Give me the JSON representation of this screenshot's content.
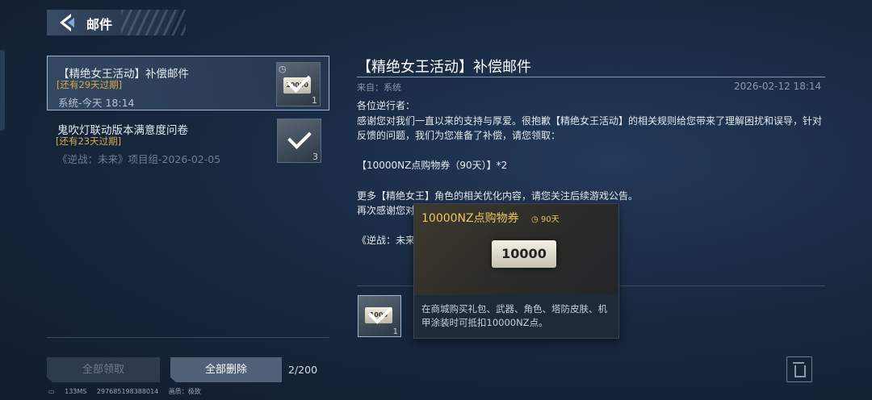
{
  "header": {
    "title": "邮件",
    "back_icon": "back-arrow-icon"
  },
  "mail_list": [
    {
      "title": "【精绝女王活动】补偿邮件",
      "expiry": "[还有29天过期]",
      "meta": "系统-今天 18:14",
      "ticket_label": "10000",
      "count": "1",
      "selected": true
    },
    {
      "title": "鬼吹灯联动版本满意度问卷",
      "expiry": "[还有23天过期]",
      "meta": "《逆战：未来》项目组-2026-02-05",
      "count": "3",
      "selected": false
    }
  ],
  "footer": {
    "collect_all": "全部领取",
    "delete_all": "全部删除",
    "mail_count": "2/200",
    "status_latency": "133MS",
    "status_id": "297685198388014",
    "status_quality": "画质：极致"
  },
  "detail": {
    "title": "【精绝女王活动】补偿邮件",
    "from": "来自：系统",
    "time": "2026-02-12 18:14",
    "body": [
      "各位逆行者：",
      "感谢您对我们一直以来的支持与厚爱。很抱歉【精绝女王活动】的相关规则给您带来了理解困扰和误导，针对",
      "反馈的问题，我们为您准备了补偿，请您领取：",
      "",
      "【10000NZ点购物券（90天）】*2",
      "",
      "更多【精绝女王】角色的相关优化内容，请您关注后续游戏公告。",
      "再次感谢您对",
      "",
      "《逆战：未来"
    ],
    "reward_ticket_label": "1000",
    "reward_count": "1"
  },
  "tooltip": {
    "name": "10000NZ点购物券",
    "duration": "90天",
    "ticket_label": "10000",
    "description": "在商城购买礼包、武器、角色、塔防皮肤、机甲涂装时可抵扣10000NZ点。"
  }
}
